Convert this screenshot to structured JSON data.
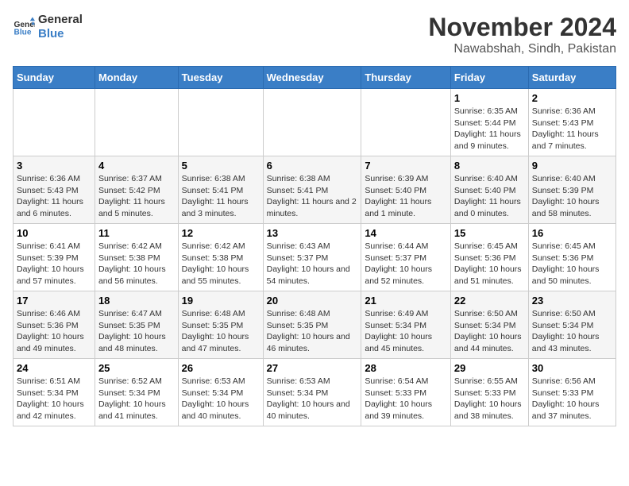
{
  "logo": {
    "line1": "General",
    "line2": "Blue"
  },
  "title": "November 2024",
  "subtitle": "Nawabshah, Sindh, Pakistan",
  "weekdays": [
    "Sunday",
    "Monday",
    "Tuesday",
    "Wednesday",
    "Thursday",
    "Friday",
    "Saturday"
  ],
  "weeks": [
    [
      {
        "day": "",
        "info": ""
      },
      {
        "day": "",
        "info": ""
      },
      {
        "day": "",
        "info": ""
      },
      {
        "day": "",
        "info": ""
      },
      {
        "day": "",
        "info": ""
      },
      {
        "day": "1",
        "info": "Sunrise: 6:35 AM\nSunset: 5:44 PM\nDaylight: 11 hours and 9 minutes."
      },
      {
        "day": "2",
        "info": "Sunrise: 6:36 AM\nSunset: 5:43 PM\nDaylight: 11 hours and 7 minutes."
      }
    ],
    [
      {
        "day": "3",
        "info": "Sunrise: 6:36 AM\nSunset: 5:43 PM\nDaylight: 11 hours and 6 minutes."
      },
      {
        "day": "4",
        "info": "Sunrise: 6:37 AM\nSunset: 5:42 PM\nDaylight: 11 hours and 5 minutes."
      },
      {
        "day": "5",
        "info": "Sunrise: 6:38 AM\nSunset: 5:41 PM\nDaylight: 11 hours and 3 minutes."
      },
      {
        "day": "6",
        "info": "Sunrise: 6:38 AM\nSunset: 5:41 PM\nDaylight: 11 hours and 2 minutes."
      },
      {
        "day": "7",
        "info": "Sunrise: 6:39 AM\nSunset: 5:40 PM\nDaylight: 11 hours and 1 minute."
      },
      {
        "day": "8",
        "info": "Sunrise: 6:40 AM\nSunset: 5:40 PM\nDaylight: 11 hours and 0 minutes."
      },
      {
        "day": "9",
        "info": "Sunrise: 6:40 AM\nSunset: 5:39 PM\nDaylight: 10 hours and 58 minutes."
      }
    ],
    [
      {
        "day": "10",
        "info": "Sunrise: 6:41 AM\nSunset: 5:39 PM\nDaylight: 10 hours and 57 minutes."
      },
      {
        "day": "11",
        "info": "Sunrise: 6:42 AM\nSunset: 5:38 PM\nDaylight: 10 hours and 56 minutes."
      },
      {
        "day": "12",
        "info": "Sunrise: 6:42 AM\nSunset: 5:38 PM\nDaylight: 10 hours and 55 minutes."
      },
      {
        "day": "13",
        "info": "Sunrise: 6:43 AM\nSunset: 5:37 PM\nDaylight: 10 hours and 54 minutes."
      },
      {
        "day": "14",
        "info": "Sunrise: 6:44 AM\nSunset: 5:37 PM\nDaylight: 10 hours and 52 minutes."
      },
      {
        "day": "15",
        "info": "Sunrise: 6:45 AM\nSunset: 5:36 PM\nDaylight: 10 hours and 51 minutes."
      },
      {
        "day": "16",
        "info": "Sunrise: 6:45 AM\nSunset: 5:36 PM\nDaylight: 10 hours and 50 minutes."
      }
    ],
    [
      {
        "day": "17",
        "info": "Sunrise: 6:46 AM\nSunset: 5:36 PM\nDaylight: 10 hours and 49 minutes."
      },
      {
        "day": "18",
        "info": "Sunrise: 6:47 AM\nSunset: 5:35 PM\nDaylight: 10 hours and 48 minutes."
      },
      {
        "day": "19",
        "info": "Sunrise: 6:48 AM\nSunset: 5:35 PM\nDaylight: 10 hours and 47 minutes."
      },
      {
        "day": "20",
        "info": "Sunrise: 6:48 AM\nSunset: 5:35 PM\nDaylight: 10 hours and 46 minutes."
      },
      {
        "day": "21",
        "info": "Sunrise: 6:49 AM\nSunset: 5:34 PM\nDaylight: 10 hours and 45 minutes."
      },
      {
        "day": "22",
        "info": "Sunrise: 6:50 AM\nSunset: 5:34 PM\nDaylight: 10 hours and 44 minutes."
      },
      {
        "day": "23",
        "info": "Sunrise: 6:50 AM\nSunset: 5:34 PM\nDaylight: 10 hours and 43 minutes."
      }
    ],
    [
      {
        "day": "24",
        "info": "Sunrise: 6:51 AM\nSunset: 5:34 PM\nDaylight: 10 hours and 42 minutes."
      },
      {
        "day": "25",
        "info": "Sunrise: 6:52 AM\nSunset: 5:34 PM\nDaylight: 10 hours and 41 minutes."
      },
      {
        "day": "26",
        "info": "Sunrise: 6:53 AM\nSunset: 5:34 PM\nDaylight: 10 hours and 40 minutes."
      },
      {
        "day": "27",
        "info": "Sunrise: 6:53 AM\nSunset: 5:34 PM\nDaylight: 10 hours and 40 minutes."
      },
      {
        "day": "28",
        "info": "Sunrise: 6:54 AM\nSunset: 5:33 PM\nDaylight: 10 hours and 39 minutes."
      },
      {
        "day": "29",
        "info": "Sunrise: 6:55 AM\nSunset: 5:33 PM\nDaylight: 10 hours and 38 minutes."
      },
      {
        "day": "30",
        "info": "Sunrise: 6:56 AM\nSunset: 5:33 PM\nDaylight: 10 hours and 37 minutes."
      }
    ]
  ]
}
